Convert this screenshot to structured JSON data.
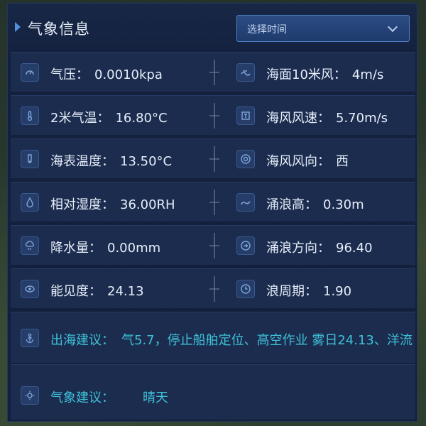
{
  "panel": {
    "title": "气象信息",
    "time_select_placeholder": "选择时间"
  },
  "rows": [
    {
      "left": {
        "icon": "gauge-icon",
        "label": "气压：",
        "value": "0.0010kpa"
      },
      "right": {
        "icon": "wave-wind-icon",
        "label": "海面10米风：",
        "value": "4m/s"
      }
    },
    {
      "left": {
        "icon": "thermometer-icon",
        "label": "2米气温：",
        "value": "16.80°C"
      },
      "right": {
        "icon": "wind-speed-icon",
        "label": "海风风速：",
        "value": "5.70m/s"
      }
    },
    {
      "left": {
        "icon": "sea-temp-icon",
        "label": "海表温度：",
        "value": "13.50°C"
      },
      "right": {
        "icon": "compass-icon",
        "label": "海风风向：",
        "value": "西"
      }
    },
    {
      "left": {
        "icon": "humidity-icon",
        "label": "相对湿度：",
        "value": "36.00RH"
      },
      "right": {
        "icon": "swell-icon",
        "label": "涌浪高：",
        "value": "0.30m"
      }
    },
    {
      "left": {
        "icon": "rain-icon",
        "label": "降水量：",
        "value": "0.00mm"
      },
      "right": {
        "icon": "direction-icon",
        "label": "涌浪方向：",
        "value": "96.40"
      }
    },
    {
      "left": {
        "icon": "visibility-icon",
        "label": "能见度：",
        "value": "24.13"
      },
      "right": {
        "icon": "period-icon",
        "label": "浪周期：",
        "value": "1.90"
      }
    }
  ],
  "sea_advice": {
    "icon": "anchor-icon",
    "label": "出海建议：",
    "value": "气5.7，停止船舶定位、高空作业  雾日24.13、洋流"
  },
  "weather_advice": {
    "icon": "weather-icon",
    "label": "气象建议：",
    "value": "晴天"
  },
  "colors": {
    "panel_bg": "#14213d",
    "row_bg": "#1b2c4e",
    "text": "#e7eef9",
    "accent": "#3fc1d8",
    "select_border": "#4d7fc4"
  }
}
